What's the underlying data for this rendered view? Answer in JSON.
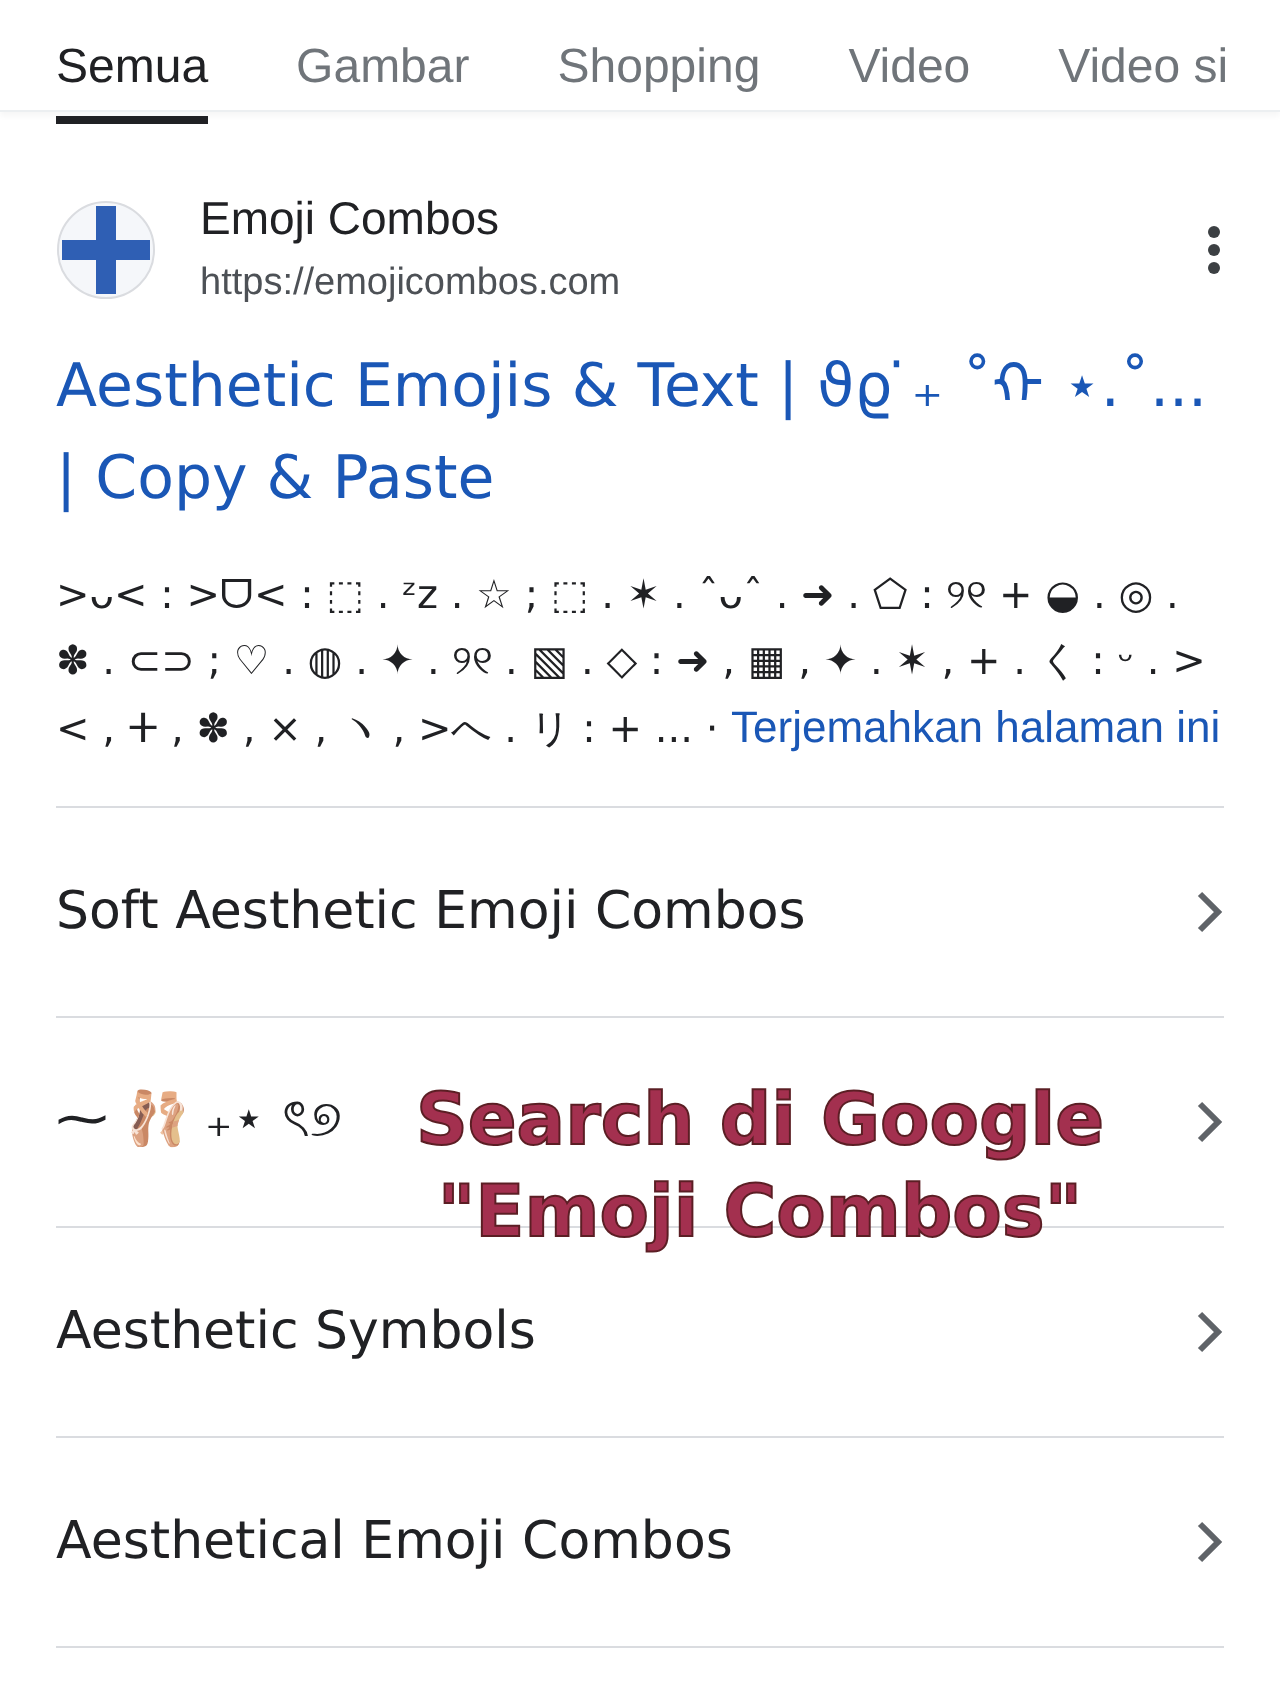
{
  "tabs": [
    {
      "label": "Semua",
      "selected": true
    },
    {
      "label": "Gambar",
      "selected": false
    },
    {
      "label": "Shopping",
      "selected": false
    },
    {
      "label": "Video",
      "selected": false
    },
    {
      "label": "Video si",
      "selected": false
    }
  ],
  "result": {
    "site_name": "Emoji Combos",
    "url": "https://emojicombos.com",
    "title": "Aesthetic Emojis & Text | ϑϱ ̇₊ ˚ᡣ ⋆.˚... | Copy & Paste",
    "snippet": ">ᴗ< : >ᗜ< : ⬚ . ᶻz . ☆ ; ⬚ . ✶ . ˆᴗˆ . ➜ . ⬠ : ୨୧ + ◒ . ◎ . ✽ . ⊂⊃ ; ♡ . ◍ . ✦ . ୨୧ . ▧ . ◇ : ➜ , ▦ , ✦ . ✶ , + . く : ᵕ . >< , ⵜ , ✽ , × , ヽ , >へ . リ : + ... ·",
    "translate_link": "Terjemahkan halaman ini"
  },
  "sitelinks": [
    {
      "label": "Soft Aesthetic Emoji Combos"
    },
    {
      "label": "⁓ 🩰 ₊⋆ ৎ୭"
    },
    {
      "label": "Aesthetic Symbols"
    },
    {
      "label": "Aesthetical Emoji Combos"
    }
  ],
  "caption": "Search di Google \"Emoji Combos\""
}
